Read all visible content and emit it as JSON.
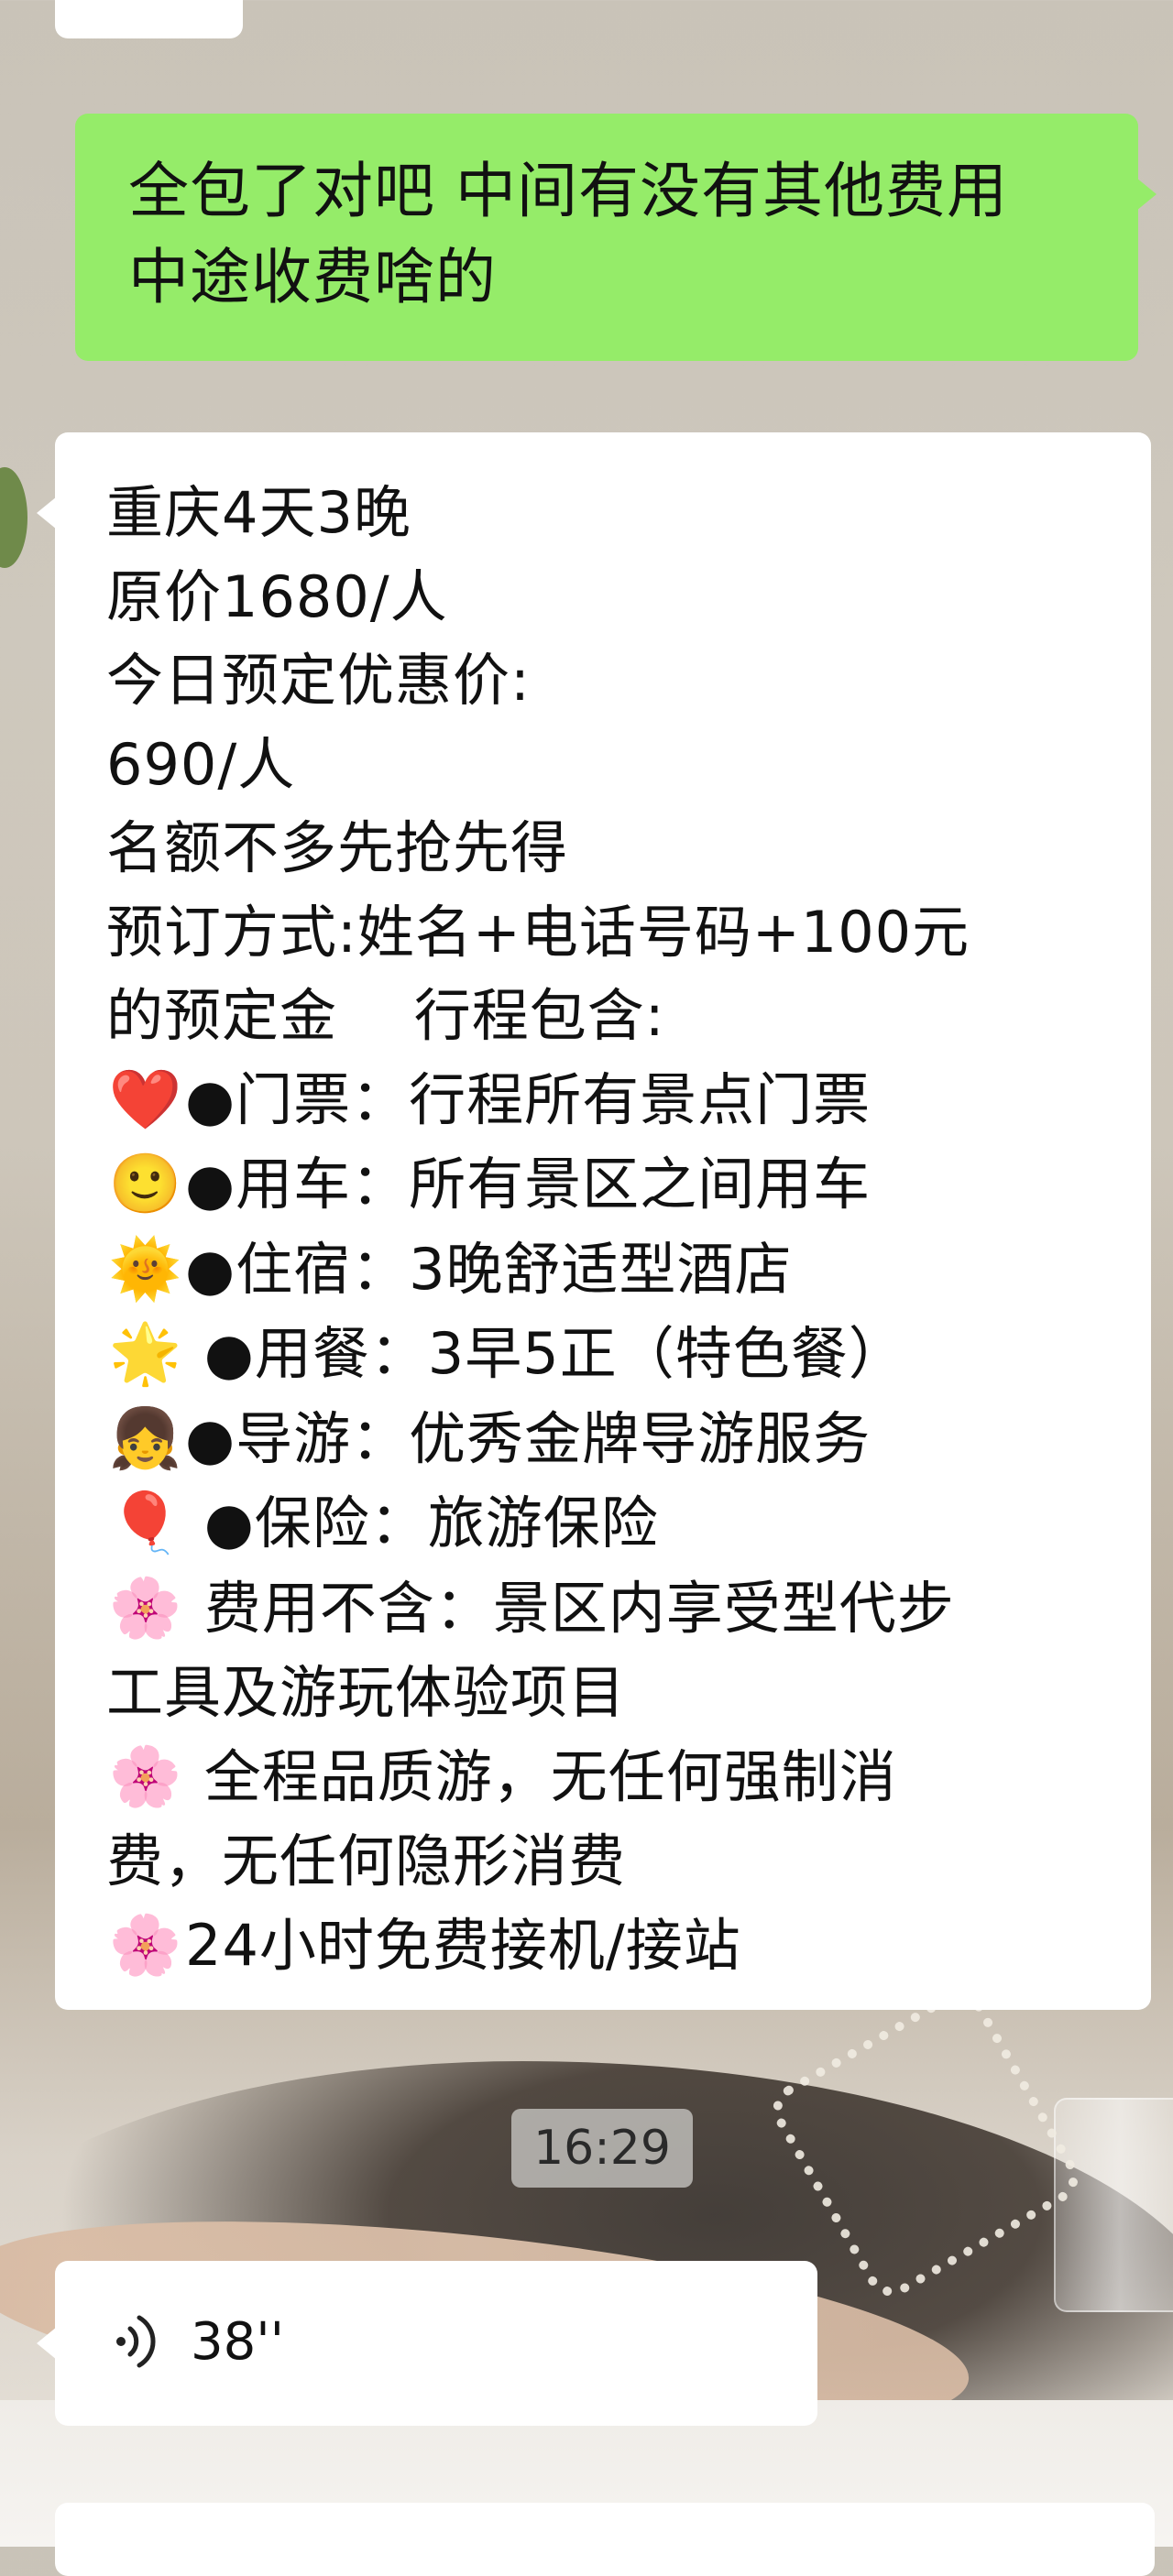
{
  "colors": {
    "outgoing_bubble": "#95ec69",
    "incoming_bubble": "#ffffff",
    "time_chip": "#c8c6c3"
  },
  "messages": {
    "outgoing": {
      "lines": [
        "全包了对吧 中间有没有其他费用",
        "中途收费啥的"
      ]
    },
    "incoming": {
      "lines": [
        {
          "emoji": "",
          "text": "重庆4天3晚"
        },
        {
          "emoji": "",
          "text": "原价1680/人"
        },
        {
          "emoji": "",
          "text": "今日预定优惠价:"
        },
        {
          "emoji": "",
          "text": "690/人"
        },
        {
          "emoji": "",
          "text": "名额不多先抢先得"
        },
        {
          "emoji": "",
          "text": "预订方式:姓名+电话号码+100元"
        },
        {
          "emoji": "",
          "text": "的预定金　 行程包含:"
        },
        {
          "emoji": "❤️",
          "text": "●门票：行程所有景点门票"
        },
        {
          "emoji": "🙂",
          "text": "●用车：所有景区之间用车"
        },
        {
          "emoji": "🌞",
          "text": "●住宿：3晚舒适型酒店"
        },
        {
          "emoji": "🌟",
          "text": " ●用餐：3早5正（特色餐）"
        },
        {
          "emoji": "👧",
          "text": "●导游：优秀金牌导游服务"
        },
        {
          "emoji": "🎈",
          "text": " ●保险：旅游保险"
        },
        {
          "emoji": "🌸",
          "text": " 费用不含：景区内享受型代步"
        },
        {
          "emoji": "",
          "text": "工具及游玩体验项目"
        },
        {
          "emoji": "🌸",
          "text": " 全程品质游，无任何强制消"
        },
        {
          "emoji": "",
          "text": "费，无任何隐形消费"
        },
        {
          "emoji": "🌸",
          "text": "24小时免费接机/接站"
        }
      ]
    },
    "timestamp": "16:29",
    "voice": {
      "duration": "38''",
      "icon": "voice-wave-icon"
    }
  }
}
